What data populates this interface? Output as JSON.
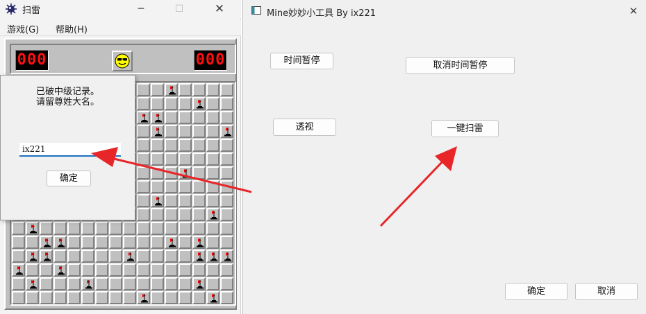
{
  "minesweeper": {
    "title": "扫雷",
    "menu": [
      "游戏(G)",
      "帮助(H)"
    ],
    "mine_counter": "000",
    "timer": "000",
    "smiley_icon": "cool-smiley-icon",
    "dialog": {
      "line1": "已破中级记录。",
      "line2": "请留尊姓大名。",
      "name_value": "ix221",
      "ok_label": "确定"
    },
    "flag_cells": [
      [
        0,
        11
      ],
      [
        1,
        13
      ],
      [
        2,
        9
      ],
      [
        2,
        10
      ],
      [
        3,
        10
      ],
      [
        3,
        15
      ],
      [
        6,
        12
      ],
      [
        8,
        10
      ],
      [
        9,
        14
      ],
      [
        10,
        1
      ],
      [
        11,
        2
      ],
      [
        11,
        3
      ],
      [
        11,
        11
      ],
      [
        11,
        13
      ],
      [
        12,
        1
      ],
      [
        12,
        2
      ],
      [
        12,
        8
      ],
      [
        12,
        13
      ],
      [
        12,
        14
      ],
      [
        12,
        15
      ],
      [
        13,
        0
      ],
      [
        13,
        3
      ],
      [
        14,
        1
      ],
      [
        14,
        5
      ],
      [
        14,
        13
      ],
      [
        15,
        9
      ],
      [
        15,
        14
      ]
    ]
  },
  "tool": {
    "title": "Mine妙妙小工具 By ix221",
    "buttons": {
      "pause": "时间暂停",
      "unpause": "取消时间暂停",
      "xray": "透视",
      "autosweep": "一键扫雷",
      "ok": "确定",
      "cancel": "取消"
    }
  },
  "colors": {
    "arrow": "#e8262a",
    "counter_text": "#ff1010",
    "input_underline": "#1a6fc2"
  }
}
